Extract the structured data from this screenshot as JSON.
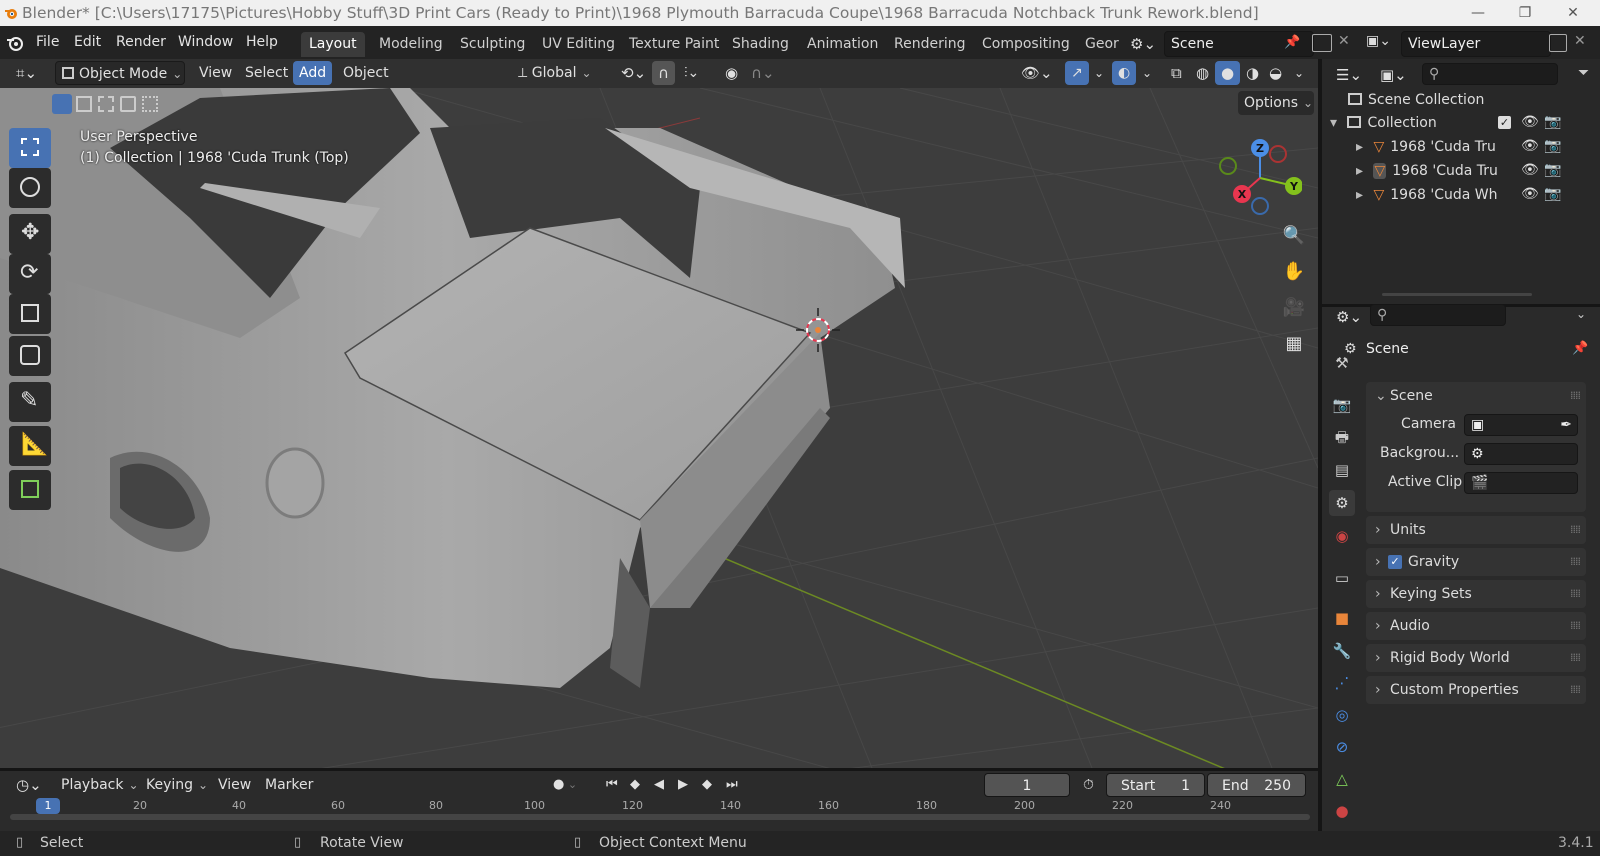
{
  "window": {
    "title": "Blender* [C:\\Users\\17175\\Pictures\\Hobby Stuff\\3D Print Cars (Ready to Print)\\1968 Plymouth Barracuda Coupe\\1968 Barracuda Notchback Trunk Rework.blend]",
    "minimize": "—",
    "maximize": "❐",
    "close": "✕"
  },
  "menu": {
    "file": "File",
    "edit": "Edit",
    "render": "Render",
    "window": "Window",
    "help": "Help"
  },
  "workspaces": [
    "Layout",
    "Modeling",
    "Sculpting",
    "UV Editing",
    "Texture Paint",
    "Shading",
    "Animation",
    "Rendering",
    "Compositing",
    "Geor"
  ],
  "scene_field": "Scene",
  "viewlayer_field": "ViewLayer",
  "viewport_header": {
    "mode": "Object Mode",
    "view": "View",
    "select": "Select",
    "add": "Add",
    "object": "Object",
    "orientation": "Global",
    "options": "Options"
  },
  "viewport": {
    "perspective": "User Perspective",
    "context": "(1) Collection | 1968 'Cuda Trunk (Top)",
    "axes": {
      "x": "X",
      "y": "Y",
      "z": "Z"
    }
  },
  "outliner": {
    "scene_collection": "Scene Collection",
    "collection": "Collection",
    "items": [
      "1968 'Cuda Tru",
      "1968 'Cuda Tru",
      "1968 'Cuda Wh"
    ]
  },
  "properties": {
    "header": "Scene",
    "scene_panel": "Scene",
    "camera_label": "Camera",
    "background_label": "Backgrou...",
    "active_clip_label": "Active Clip",
    "panels": [
      "Units",
      "Gravity",
      "Keying Sets",
      "Audio",
      "Rigid Body World",
      "Custom Properties"
    ],
    "gravity_checked": true
  },
  "timeline": {
    "playback": "Playback",
    "keying": "Keying",
    "view": "View",
    "marker": "Marker",
    "current_frame": "1",
    "start_label": "Start",
    "start": "1",
    "end_label": "End",
    "end": "250",
    "ticks": [
      "1",
      "20",
      "40",
      "60",
      "80",
      "100",
      "120",
      "140",
      "160",
      "180",
      "200",
      "220",
      "240"
    ]
  },
  "statusbar": {
    "select": "Select",
    "rotate": "Rotate View",
    "context_menu": "Object Context Menu",
    "version": "3.4.1"
  },
  "colors": {
    "accent": "#4772b3",
    "x_axis": "#e8364f",
    "y_axis": "#84c11c",
    "z_axis": "#4b8ee6",
    "orange": "#e8853a"
  }
}
